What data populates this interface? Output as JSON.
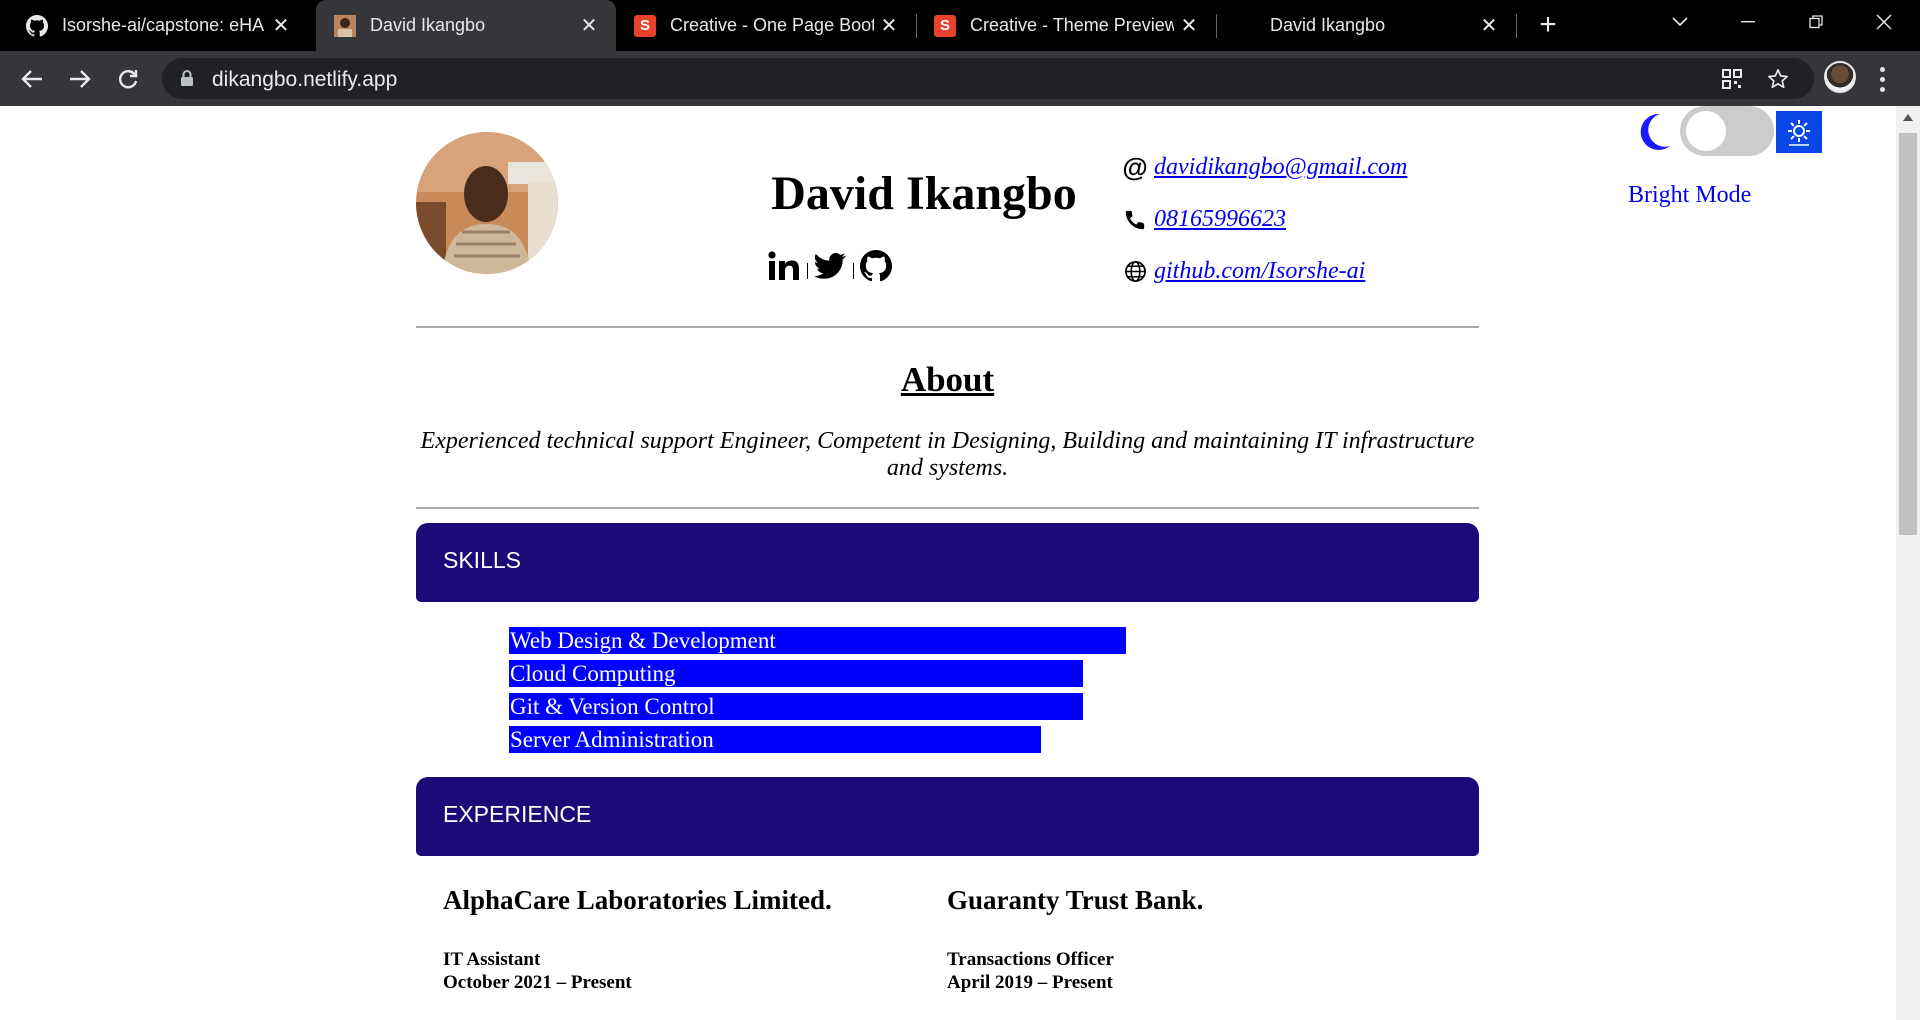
{
  "browser": {
    "tabs": [
      {
        "title": "Isorshe-ai/capstone: eHA",
        "favicon": "github-icon",
        "active": false
      },
      {
        "title": "David Ikangbo",
        "favicon": "photo-thumbnail-icon",
        "active": true
      },
      {
        "title": "Creative - One Page Boots",
        "favicon": "s-logo-icon",
        "active": false
      },
      {
        "title": "Creative - Theme Preview",
        "favicon": "s-logo-icon",
        "active": false
      },
      {
        "title": "David Ikangbo",
        "favicon": "none",
        "active": false
      }
    ],
    "new_tab": "+",
    "url": "dikangbo.netlify.app"
  },
  "page": {
    "name": "David Ikangbo",
    "socials": [
      "linkedin-icon",
      "twitter-icon",
      "github-icon"
    ],
    "contacts": [
      {
        "icon": "at-icon",
        "text": "davidikangbo@gmail.com"
      },
      {
        "icon": "phone-icon",
        "text": "08165996623"
      },
      {
        "icon": "globe-icon",
        "text": "github.com/Isorshe-ai"
      }
    ],
    "theme": {
      "mode_label": "Bright Mode",
      "toggle_on": false
    },
    "about": {
      "title": "About",
      "text": "Experienced technical support Engineer, Competent in Designing, Building and maintaining IT infrastructure and systems."
    },
    "skills": {
      "title": "SKILLS",
      "items": [
        {
          "label": "Web Design & Development",
          "level": 0.58
        },
        {
          "label": "Cloud Computing",
          "level": 0.54
        },
        {
          "label": "Git & Version Control",
          "level": 0.54
        },
        {
          "label": "Server Administration",
          "level": 0.5
        }
      ]
    },
    "experience": {
      "title": "EXPERIENCE",
      "jobs": [
        {
          "company": "AlphaCare Laboratories Limited.",
          "role": "IT Assistant",
          "dates": "October 2021 – Present"
        },
        {
          "company": "Guaranty Trust Bank.",
          "role": "Transactions Officer",
          "dates": "April 2019 – Present"
        }
      ]
    }
  },
  "colors": {
    "section_bar": "#1c0a78",
    "skill_bar": "#0000ff",
    "link": "#0000ee",
    "sun_button": "#0a46e6"
  }
}
